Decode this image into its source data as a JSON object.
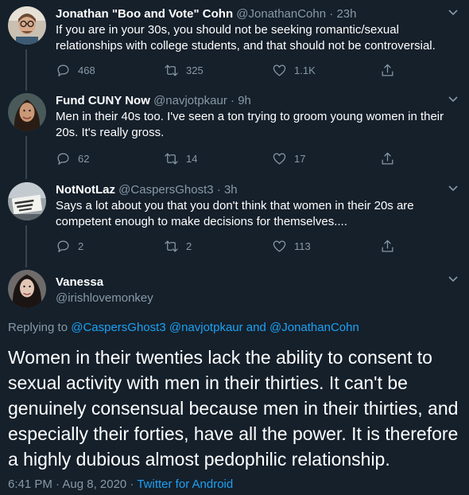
{
  "colors": {
    "background": "#15202b",
    "primary_text": "#ffffff",
    "secondary_text": "#8899a6",
    "accent": "#1da1f2",
    "divider": "#38444d"
  },
  "tweets": [
    {
      "display_name": "Jonathan \"Boo and Vote\" Cohn",
      "handle": "@JonathanCohn",
      "time": "23h",
      "text": "If you are in your 30s, you should not be seeking romantic/sexual relationships with college students, and that should not be controversial.",
      "replies": "468",
      "retweets": "325",
      "likes": "1.1K"
    },
    {
      "display_name": "Fund CUNY Now",
      "handle": "@navjotpkaur",
      "time": "9h",
      "text": "Men in their 40s too. I've seen a ton trying to groom young women in their 20s. It's really gross.",
      "replies": "62",
      "retweets": "14",
      "likes": "17"
    },
    {
      "display_name": "NotNotLaz",
      "handle": "@CaspersGhost3",
      "time": "3h",
      "text": "Says a lot about you that you don't think that women in their 20s are competent enough to make decisions for themselves....",
      "replies": "2",
      "retweets": "2",
      "likes": "113"
    }
  ],
  "focused_tweet": {
    "display_name": "Vanessa",
    "handle": "@irishlovemonkey",
    "replying_prefix": "Replying to",
    "replying_to": [
      "@CaspersGhost3",
      "@navjotpkaur",
      "@JonathanCohn"
    ],
    "replying_and": "and",
    "text": "Women in their twenties lack the ability to consent to sexual activity with men in their thirties. It can't be genuinely consensual because men in their thirties, and especially their forties, have all the power. It is therefore a highly dubious almost pedophilic relationship.",
    "timestamp": "6:41 PM · Aug 8, 2020 ·",
    "source": "Twitter for Android"
  }
}
